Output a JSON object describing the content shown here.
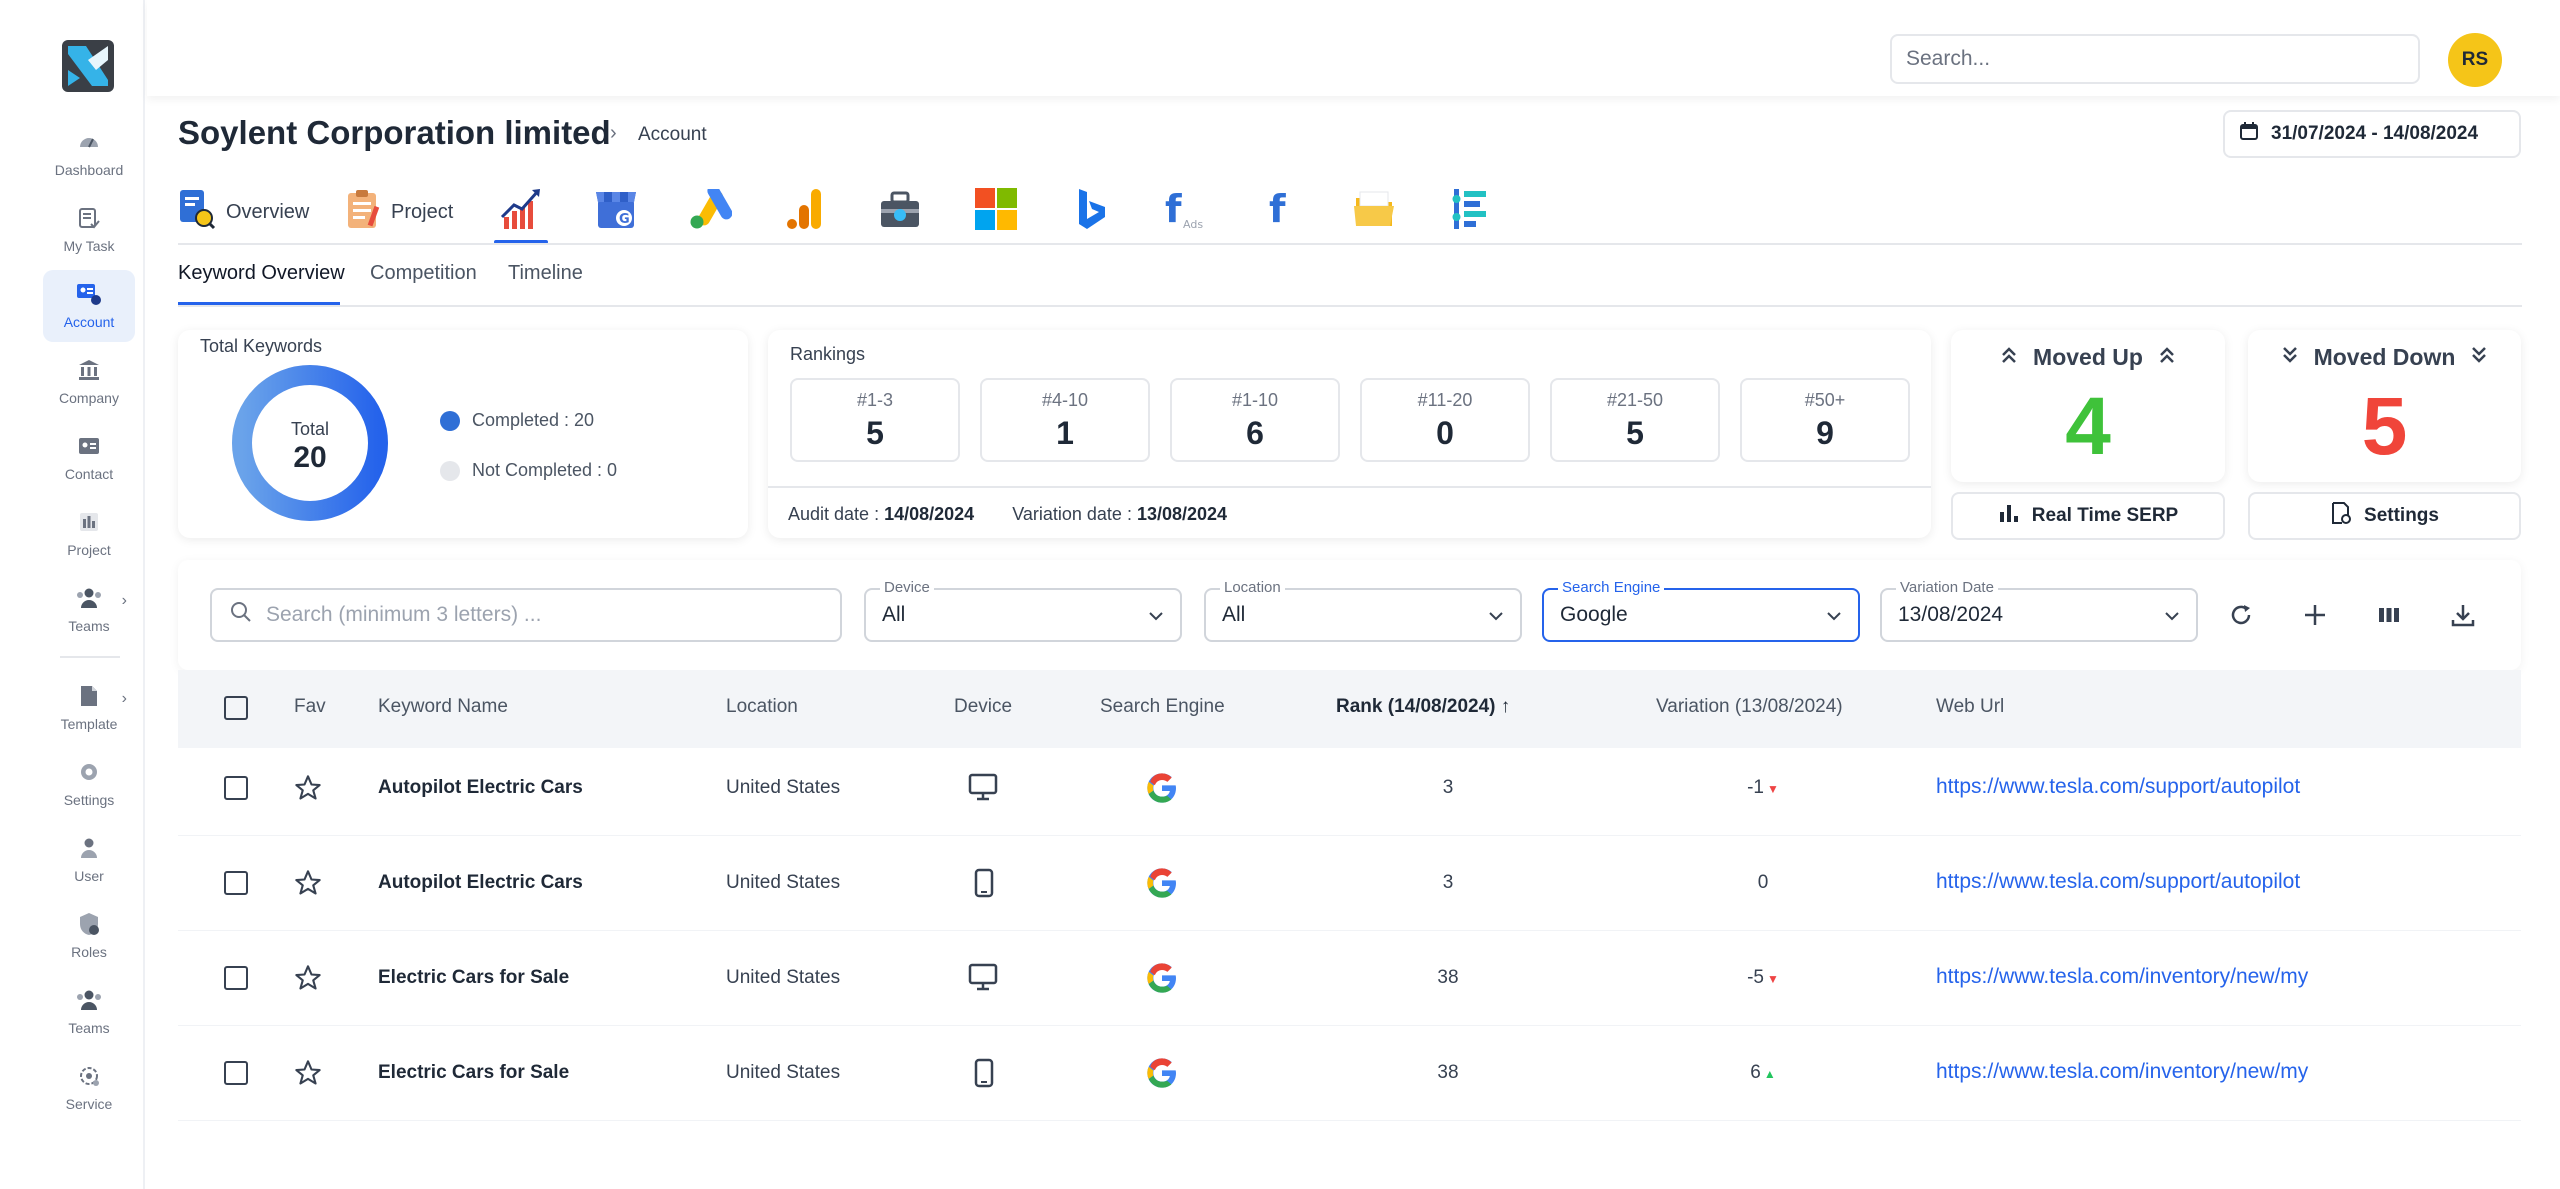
{
  "sidebar": {
    "items": [
      {
        "label": "Dashboard",
        "icon": "dashboard-icon"
      },
      {
        "label": "My Task",
        "icon": "task-icon"
      },
      {
        "label": "Account",
        "icon": "account-icon",
        "active": true
      },
      {
        "label": "Company",
        "icon": "company-icon"
      },
      {
        "label": "Contact",
        "icon": "contact-icon"
      },
      {
        "label": "Project",
        "icon": "project-icon"
      },
      {
        "label": "Teams",
        "icon": "teams-icon"
      },
      {
        "label": "Template",
        "icon": "template-icon"
      },
      {
        "label": "Settings",
        "icon": "settings-icon"
      },
      {
        "label": "User",
        "icon": "user-icon"
      },
      {
        "label": "Roles",
        "icon": "roles-icon"
      },
      {
        "label": "Teams",
        "icon": "teams-icon"
      },
      {
        "label": "Service",
        "icon": "service-icon"
      }
    ]
  },
  "topbar": {
    "search_placeholder": "Search...",
    "avatar_initials": "RS"
  },
  "header": {
    "title": "Soylent Corporation limited",
    "breadcrumb": "Account",
    "date_range": "31/07/2024 - 14/08/2024"
  },
  "platform_tabs": [
    {
      "label": "Overview",
      "icon": "overview-icon"
    },
    {
      "label": "Project",
      "icon": "project-clipboard-icon"
    },
    {
      "label": "",
      "icon": "rank-growth-icon",
      "active": true
    },
    {
      "label": "",
      "icon": "google-business-icon"
    },
    {
      "label": "",
      "icon": "google-ads-icon"
    },
    {
      "label": "",
      "icon": "google-analytics-icon"
    },
    {
      "label": "",
      "icon": "toolbox-icon"
    },
    {
      "label": "",
      "icon": "microsoft-icon"
    },
    {
      "label": "",
      "icon": "bing-icon"
    },
    {
      "label": "",
      "icon": "facebook-ads-icon"
    },
    {
      "label": "",
      "icon": "facebook-icon"
    },
    {
      "label": "",
      "icon": "folder-icon"
    },
    {
      "label": "",
      "icon": "sliders-icon"
    }
  ],
  "sub_tabs": [
    "Keyword Overview",
    "Competition",
    "Timeline"
  ],
  "total_keywords": {
    "label": "Total Keywords",
    "center_label": "Total",
    "total": "20",
    "completed": "Completed : 20",
    "not_completed": "Not Completed : 0",
    "completed_color": "#2f6fd6",
    "not_completed_color": "#e5e7eb",
    "completed_fraction": 1.0
  },
  "rankings": {
    "label": "Rankings",
    "boxes": [
      {
        "label": "#1-3",
        "value": "5"
      },
      {
        "label": "#4-10",
        "value": "1"
      },
      {
        "label": "#1-10",
        "value": "6"
      },
      {
        "label": "#11-20",
        "value": "0"
      },
      {
        "label": "#21-50",
        "value": "5"
      },
      {
        "label": "#50+",
        "value": "9"
      }
    ],
    "audit_label": "Audit date : ",
    "audit_date": "14/08/2024",
    "variation_label": "Variation date : ",
    "variation_date": "13/08/2024"
  },
  "moved_up": {
    "label": "Moved Up",
    "value": "4",
    "color": "#3fc23a"
  },
  "moved_down": {
    "label": "Moved Down",
    "value": "5",
    "color": "#f0453a"
  },
  "buttons": {
    "real_time_serp": "Real Time SERP",
    "settings": "Settings"
  },
  "filters": {
    "search_placeholder": "Search (minimum 3 letters) ...",
    "device": {
      "label": "Device",
      "value": "All"
    },
    "location": {
      "label": "Location",
      "value": "All"
    },
    "search_engine": {
      "label": "Search Engine",
      "value": "Google"
    },
    "variation_date": {
      "label": "Variation Date",
      "value": "13/08/2024"
    }
  },
  "table": {
    "headers": {
      "fav": "Fav",
      "keyword": "Keyword Name",
      "location": "Location",
      "device": "Device",
      "engine": "Search Engine",
      "rank": "Rank (14/08/2024)",
      "variation": "Variation (13/08/2024)",
      "url": "Web Url"
    },
    "rows": [
      {
        "keyword": "Autopilot Electric Cars",
        "location": "United States",
        "device": "desktop",
        "rank": "3",
        "variation": "-1",
        "trend": "down",
        "url": "https://www.tesla.com/support/autopilot"
      },
      {
        "keyword": "Autopilot Electric Cars",
        "location": "United States",
        "device": "mobile",
        "rank": "3",
        "variation": "0",
        "trend": "none",
        "url": "https://www.tesla.com/support/autopilot"
      },
      {
        "keyword": "Electric Cars for Sale",
        "location": "United States",
        "device": "desktop",
        "rank": "38",
        "variation": "-5",
        "trend": "down",
        "url": "https://www.tesla.com/inventory/new/my"
      },
      {
        "keyword": "Electric Cars for Sale",
        "location": "United States",
        "device": "mobile",
        "rank": "38",
        "variation": "6",
        "trend": "up",
        "url": "https://www.tesla.com/inventory/new/my"
      }
    ]
  }
}
